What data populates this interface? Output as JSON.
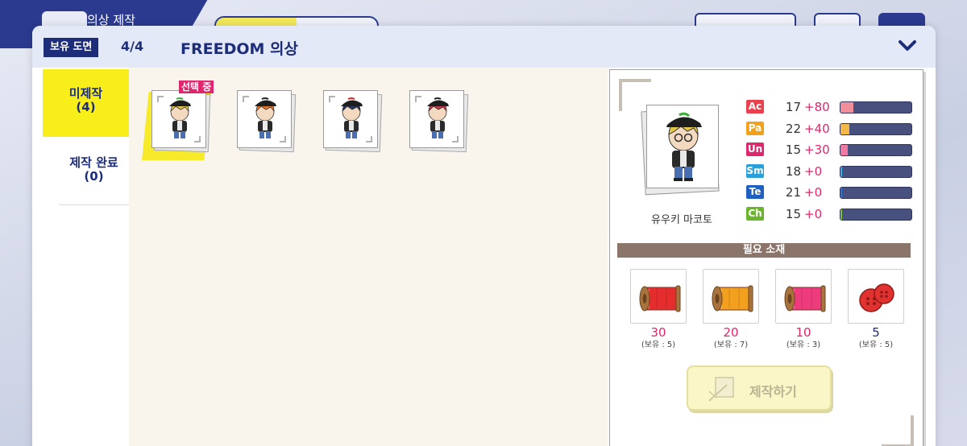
{
  "background": {
    "title": "의상 제작"
  },
  "header": {
    "badge": "보유 도면",
    "count": "4/4",
    "title": "FREEDOM 의상"
  },
  "tabs": {
    "unmade_label": "미제작",
    "unmade_count": "(4)",
    "done_label": "제작 완료",
    "done_count": "(0)"
  },
  "grid": {
    "selected_tag": "선택 중",
    "cards": [
      {
        "hair": "#e3c74a",
        "hat_accent": "#3fae3a"
      },
      {
        "hair": "#e8782a",
        "hat_accent": "#222222"
      },
      {
        "hair": "#23345e",
        "hat_accent": "#d4262b"
      },
      {
        "hair": "#c43a4f",
        "hat_accent": "#222222"
      }
    ]
  },
  "character": {
    "name": "유우키 마코토"
  },
  "stats": [
    {
      "icon": "Ac",
      "color": "#e8424e",
      "base": "17",
      "plus": "+80",
      "fill": 0.18,
      "fill_color": "#f08f9a"
    },
    {
      "icon": "Pa",
      "color": "#f2a11b",
      "base": "22",
      "plus": "+40",
      "fill": 0.12,
      "fill_color": "#f5b746"
    },
    {
      "icon": "Un",
      "color": "#e0266c",
      "base": "15",
      "plus": "+30",
      "fill": 0.1,
      "fill_color": "#f07aa4"
    },
    {
      "icon": "Sm",
      "color": "#2a9fd8",
      "base": "18",
      "plus": "+0",
      "fill": 0.02,
      "fill_color": "#3ab0e6"
    },
    {
      "icon": "Te",
      "color": "#1e5fbf",
      "base": "21",
      "plus": "+0",
      "fill": 0.02,
      "fill_color": "#2f73d6"
    },
    {
      "icon": "Ch",
      "color": "#6bb42e",
      "base": "15",
      "plus": "+0",
      "fill": 0.02,
      "fill_color": "#7cc43e"
    }
  ],
  "materials": {
    "header": "필요 소재",
    "items": [
      {
        "icon": "red-thread-spool-icon",
        "color": "#e52d2d",
        "need": "30",
        "have": "(보유 : 5)"
      },
      {
        "icon": "orange-thread-spool-icon",
        "color": "#f2a01e",
        "need": "20",
        "have": "(보유 : 7)"
      },
      {
        "icon": "pink-thread-spool-icon",
        "color": "#ee3b7d",
        "need": "10",
        "have": "(보유 : 3)"
      },
      {
        "icon": "red-button-icon",
        "color": "#e2322f",
        "need": "5",
        "have": "(보유 : 5)"
      }
    ]
  },
  "make_button": {
    "label": "제작하기"
  }
}
